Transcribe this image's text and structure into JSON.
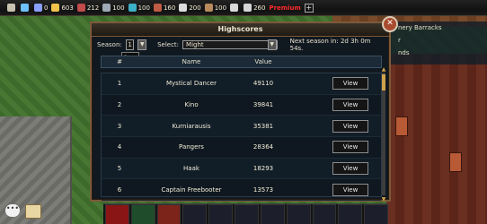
{
  "topbar": {
    "resources": [
      {
        "icon": "sword-icon",
        "value": ""
      },
      {
        "icon": "lightning-icon",
        "value": ""
      },
      {
        "icon": "flask-icon",
        "value": "0"
      },
      {
        "icon": "coin-icon",
        "value": "603"
      },
      {
        "icon": "fist-icon",
        "value": "212"
      },
      {
        "icon": "pick-icon",
        "value": "100"
      },
      {
        "icon": "trident-icon",
        "value": "100"
      },
      {
        "icon": "skull-icon",
        "value": "160"
      },
      {
        "icon": "card-icon",
        "value": "200"
      },
      {
        "icon": "book-icon",
        "value": "100"
      },
      {
        "icon": "x-icon",
        "value": ""
      },
      {
        "icon": "shield-icon",
        "value": "260"
      }
    ],
    "premium": "Premium"
  },
  "side_panel": {
    "items": [
      "nery Barracks",
      "r",
      "nds"
    ]
  },
  "dialog": {
    "title": "Highscores",
    "season_label": "Season:",
    "season_value": "1",
    "select_label": "Select:",
    "select_value": "Might",
    "next_season": "Next season in: 2d 3h 0m 54s.",
    "dropdown_option": "1",
    "columns": {
      "rank": "#",
      "name": "Name",
      "value": "Value"
    },
    "rows": [
      {
        "rank": "1",
        "name": "Mystical Dancer",
        "value": "49110",
        "action": "View"
      },
      {
        "rank": "2",
        "name": "Kino",
        "value": "39841",
        "action": "View"
      },
      {
        "rank": "3",
        "name": "Kurniarausis",
        "value": "35381",
        "action": "View"
      },
      {
        "rank": "4",
        "name": "Pangers",
        "value": "28364",
        "action": "View"
      },
      {
        "rank": "5",
        "name": "Haak",
        "value": "18293",
        "action": "View"
      },
      {
        "rank": "6",
        "name": "Captain Freebooter",
        "value": "13573",
        "action": "View"
      }
    ]
  }
}
